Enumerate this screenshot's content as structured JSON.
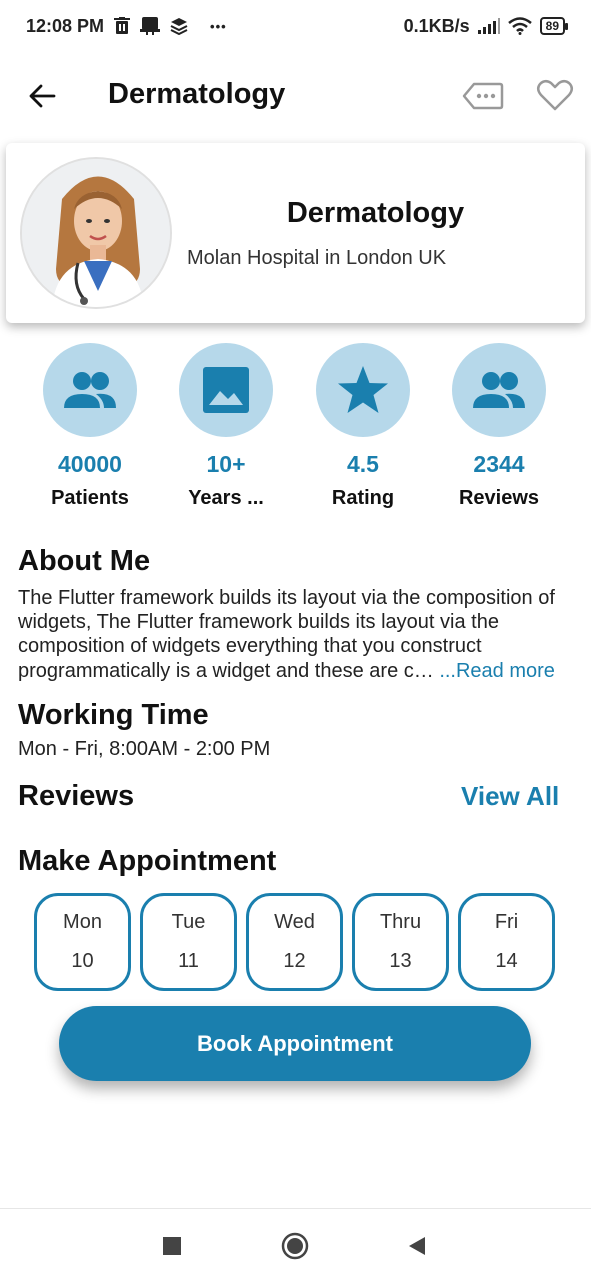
{
  "status_bar": {
    "time": "12:08 PM",
    "network_speed": "0.1KB/s",
    "battery": "89",
    "more_dots": "•••"
  },
  "app_bar": {
    "title": "Dermatology",
    "icons": [
      "back-arrow-icon",
      "tag-icon",
      "heart-icon"
    ]
  },
  "profile": {
    "title": "Dermatology",
    "subtitle": "Molan Hospital in London UK"
  },
  "stats": [
    {
      "value": "40000",
      "label": "Patients",
      "icon": "people-icon"
    },
    {
      "value": "10+",
      "label": "Years ...",
      "icon": "image-icon"
    },
    {
      "value": "4.5",
      "label": "Rating",
      "icon": "star-icon"
    },
    {
      "value": "2344",
      "label": "Reviews",
      "icon": "people-icon"
    }
  ],
  "about": {
    "title": "About Me",
    "text": "The Flutter framework builds its layout via the composition of widgets, The Flutter framework builds its layout via the composition of widgets everything that you construct programmatically is a widget and these are c… ",
    "read_more": "...Read more"
  },
  "working_time": {
    "title": "Working Time",
    "text": "Mon - Fri, 8:00AM - 2:00 PM"
  },
  "reviews": {
    "title": "Reviews",
    "view_all": "View All"
  },
  "appointment": {
    "title": "Make Appointment",
    "days": [
      {
        "name": "Mon",
        "date": "10"
      },
      {
        "name": "Tue",
        "date": "11"
      },
      {
        "name": "Wed",
        "date": "12"
      },
      {
        "name": "Thru",
        "date": "13"
      },
      {
        "name": "Fri",
        "date": "14"
      }
    ],
    "button": "Book Appointment"
  },
  "colors": {
    "accent": "#1a7fae",
    "icon_bg": "#b6d8ea"
  }
}
